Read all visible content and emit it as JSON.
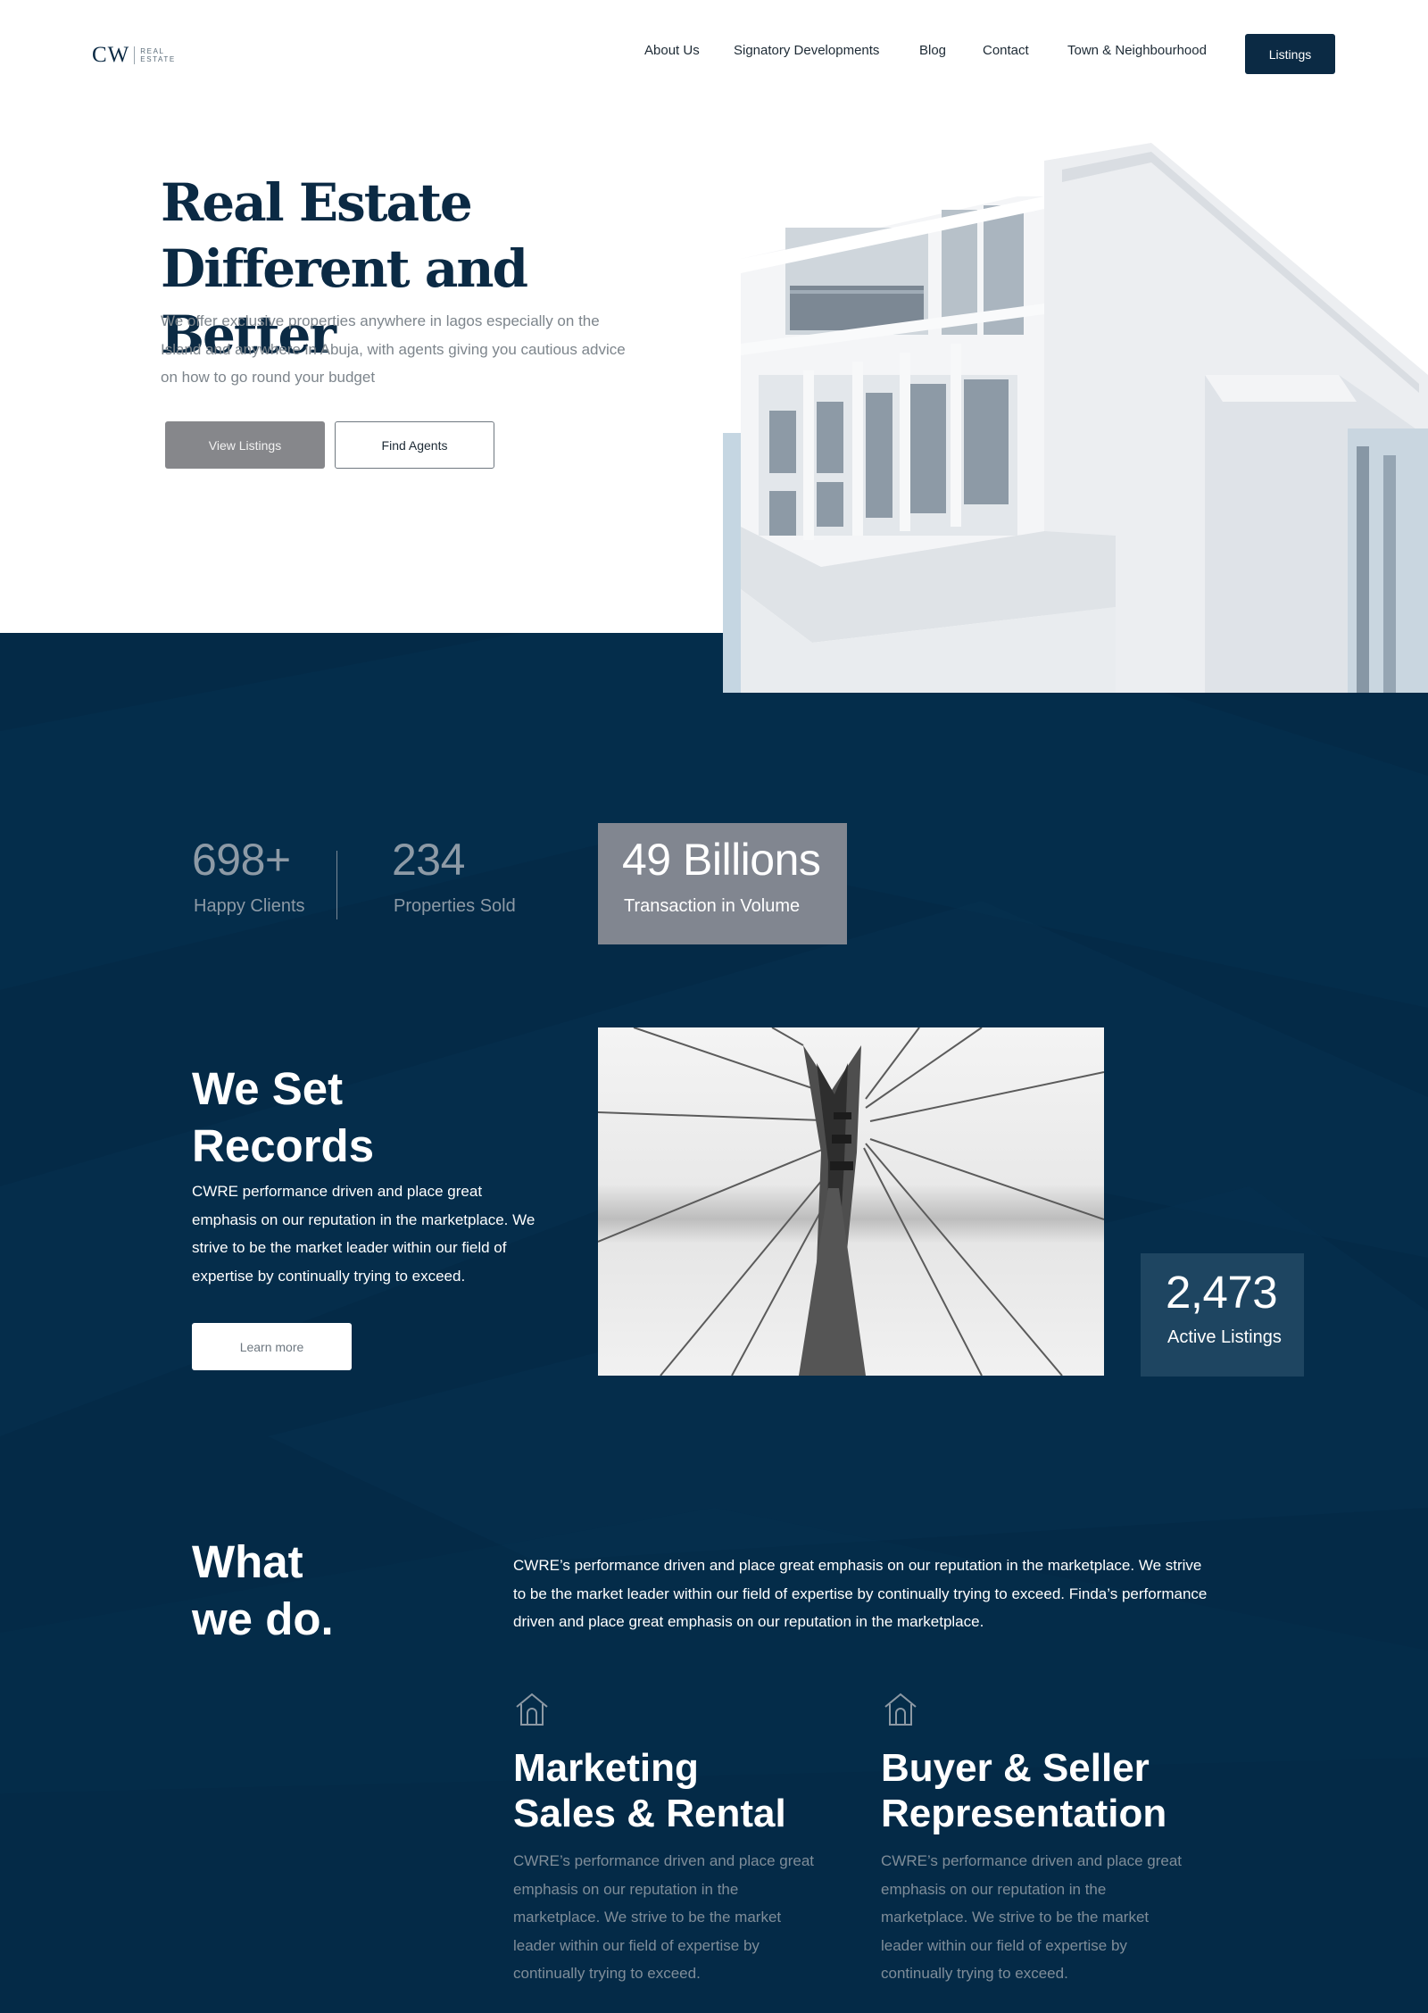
{
  "header": {
    "logo_mark": "CW",
    "logo_text_line1": "REAL",
    "logo_text_line2": "ESTATE",
    "nav": [
      "About Us",
      "Signatory Developments",
      "Blog",
      "Contact",
      "Town & Neighbourhood"
    ],
    "listings_button": "Listings"
  },
  "hero": {
    "title_line1": "Real Estate",
    "title_line2": "Different and Better",
    "description": "We offer exclusive properties anywhere in lagos especially on the Island and anywhere in Abuja, with agents giving you cautious advice on how to go round your budget",
    "view_button": "View Listings",
    "find_button": "Find Agents"
  },
  "stats": {
    "clients_value": "698+",
    "clients_label": "Happy Clients",
    "sold_value": "234",
    "sold_label": "Properties Sold",
    "volume_value": "49 Billions",
    "volume_label": "Transaction in Volume"
  },
  "records": {
    "title_line1": "We Set",
    "title_line2": "Records",
    "description": "CWRE performance driven and place great emphasis on our reputation in the marketplace. We strive to be the market leader within our field of expertise by continually trying to exceed.",
    "learn_button": "Learn more",
    "active_value": "2,473",
    "active_label": "Active Listings"
  },
  "what_we_do": {
    "title_line1": "What",
    "title_line2": "we do.",
    "description": "CWRE’s performance driven and place great emphasis on our reputation in the marketplace. We strive to be the market leader within our field of expertise by continually trying to exceed. Finda’s performance driven and place great emphasis on our reputation in the marketplace.",
    "services": [
      {
        "icon": "house-icon",
        "title_line1": "Marketing",
        "title_line2": "Sales & Rental",
        "description": "CWRE’s performance driven and place great emphasis on our reputation in the marketplace. We strive to be the market leader within our field of expertise by continually trying to exceed."
      },
      {
        "icon": "house-icon",
        "title_line1": "Buyer & Seller",
        "title_line2": "Representation",
        "description": "CWRE’s performance driven and place great emphasis on our reputation in the marketplace. We strive to be the market leader within our field of expertise by continually trying to exceed."
      }
    ]
  },
  "colors": {
    "navy": "#042a47",
    "button_navy": "#0b2a44",
    "gray_button": "#86878b",
    "stat_box": "#818690",
    "active_box": "#1e4561"
  }
}
